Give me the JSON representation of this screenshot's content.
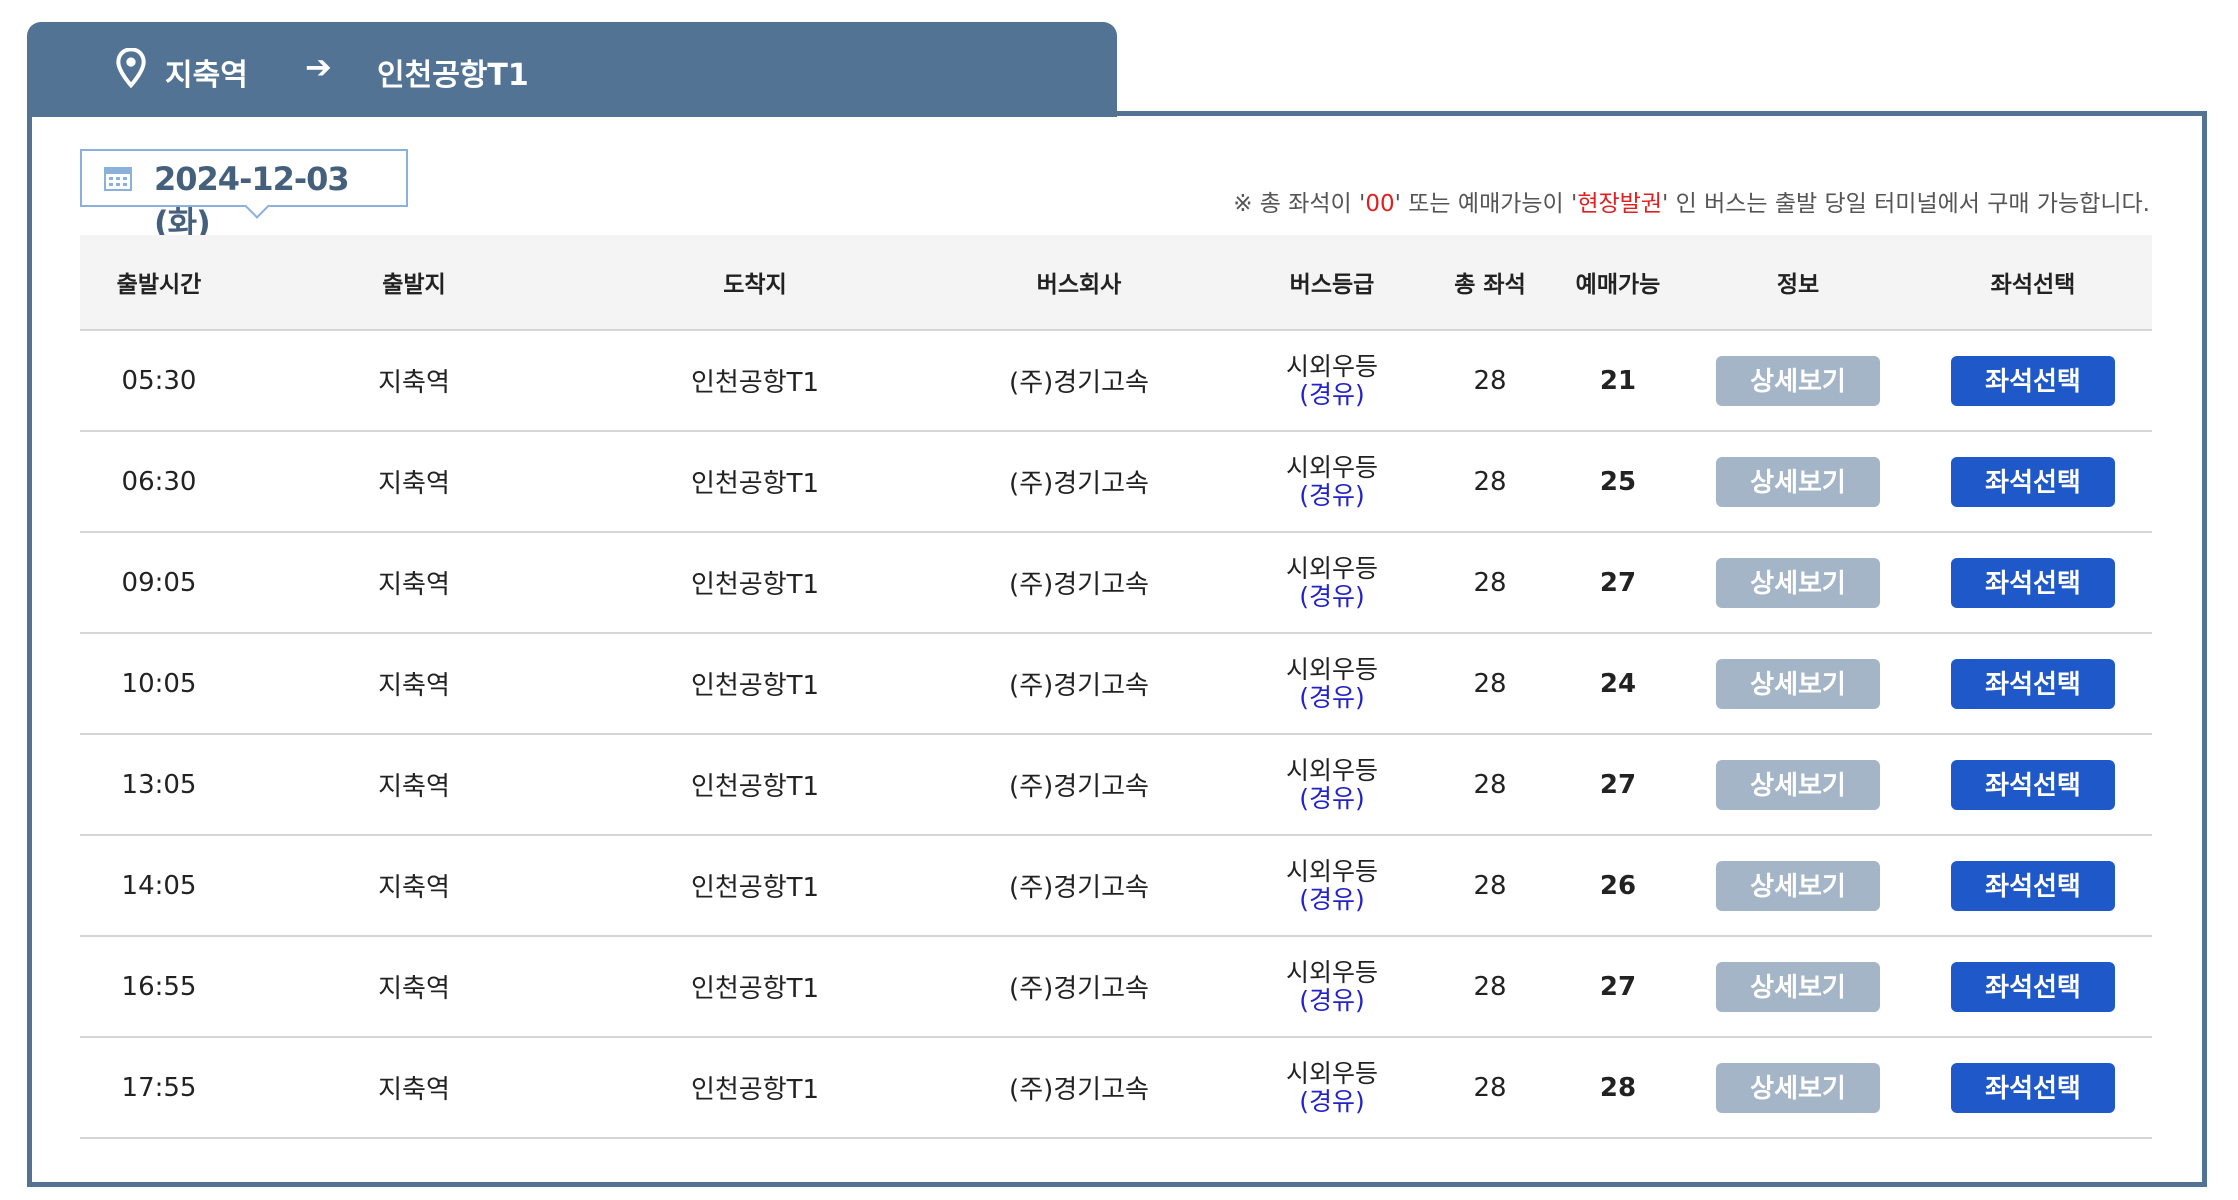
{
  "route": {
    "from": "지축역",
    "to": "인천공항T1",
    "from_icon": "map-pin-icon",
    "arrow_icon": "arrow-right-icon"
  },
  "date": {
    "value": "2024-12-03 (화)",
    "icon": "calendar-icon"
  },
  "notice": {
    "part1": "※ 총 좌석이 '",
    "red1": "00",
    "part2": "' 또는 예매가능이 '",
    "red2": "현장발권",
    "part3": "' 인 버스는 출발 당일 터미널에서 구매 가능합니다."
  },
  "colors": {
    "header_tab": "#527393",
    "detail_button": "#a4b5c7",
    "seat_button": "#1f58c8",
    "notice_red": "#e02020",
    "grade_sub": "#2222cc"
  },
  "table": {
    "headers": [
      "출발시간",
      "출발지",
      "도착지",
      "버스회사",
      "버스등급",
      "총 좌석",
      "예매가능",
      "정보",
      "좌석선택"
    ],
    "rows": [
      {
        "time": "05:30",
        "origin": "지축역",
        "dest": "인천공항T1",
        "company": "(주)경기고속",
        "grade": "시외우등",
        "grade_sub": "(경유)",
        "total": "28",
        "avail": "21",
        "detail": "상세보기",
        "seat": "좌석선택"
      },
      {
        "time": "06:30",
        "origin": "지축역",
        "dest": "인천공항T1",
        "company": "(주)경기고속",
        "grade": "시외우등",
        "grade_sub": "(경유)",
        "total": "28",
        "avail": "25",
        "detail": "상세보기",
        "seat": "좌석선택"
      },
      {
        "time": "09:05",
        "origin": "지축역",
        "dest": "인천공항T1",
        "company": "(주)경기고속",
        "grade": "시외우등",
        "grade_sub": "(경유)",
        "total": "28",
        "avail": "27",
        "detail": "상세보기",
        "seat": "좌석선택"
      },
      {
        "time": "10:05",
        "origin": "지축역",
        "dest": "인천공항T1",
        "company": "(주)경기고속",
        "grade": "시외우등",
        "grade_sub": "(경유)",
        "total": "28",
        "avail": "24",
        "detail": "상세보기",
        "seat": "좌석선택"
      },
      {
        "time": "13:05",
        "origin": "지축역",
        "dest": "인천공항T1",
        "company": "(주)경기고속",
        "grade": "시외우등",
        "grade_sub": "(경유)",
        "total": "28",
        "avail": "27",
        "detail": "상세보기",
        "seat": "좌석선택"
      },
      {
        "time": "14:05",
        "origin": "지축역",
        "dest": "인천공항T1",
        "company": "(주)경기고속",
        "grade": "시외우등",
        "grade_sub": "(경유)",
        "total": "28",
        "avail": "26",
        "detail": "상세보기",
        "seat": "좌석선택"
      },
      {
        "time": "16:55",
        "origin": "지축역",
        "dest": "인천공항T1",
        "company": "(주)경기고속",
        "grade": "시외우등",
        "grade_sub": "(경유)",
        "total": "28",
        "avail": "27",
        "detail": "상세보기",
        "seat": "좌석선택"
      },
      {
        "time": "17:55",
        "origin": "지축역",
        "dest": "인천공항T1",
        "company": "(주)경기고속",
        "grade": "시외우등",
        "grade_sub": "(경유)",
        "total": "28",
        "avail": "28",
        "detail": "상세보기",
        "seat": "좌석선택"
      }
    ]
  }
}
